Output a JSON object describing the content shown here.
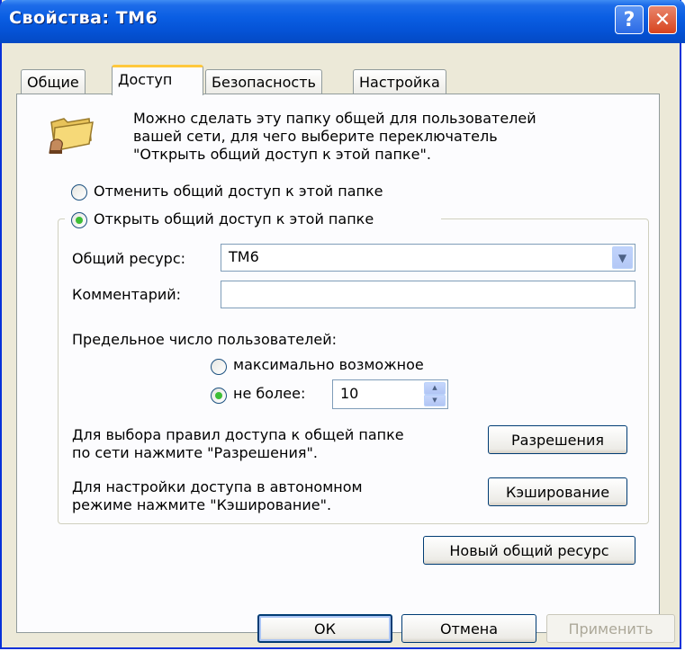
{
  "window": {
    "title": "Свойства: ТМ6"
  },
  "titlebar": {
    "help_glyph": "?",
    "close_glyph": "✕"
  },
  "tabs": [
    {
      "label": "Общие",
      "active": false
    },
    {
      "label": "Доступ",
      "active": true
    },
    {
      "label": "Безопасность",
      "active": false
    },
    {
      "label": "Настройка",
      "active": false
    }
  ],
  "intro": {
    "icon": "shared-folder-icon",
    "lines": [
      "Можно сделать эту папку общей для пользователей",
      "вашей сети, для чего выберите переключатель",
      "\"Открыть общий доступ к этой папке\"."
    ]
  },
  "sharing": {
    "option_off": "Отменить общий доступ к этой папке",
    "option_on": "Открыть общий доступ к этой папке",
    "selected": "on"
  },
  "share_name": {
    "label": "Общий ресурс:",
    "value": "ТМ6"
  },
  "comment": {
    "label": "Комментарий:",
    "value": ""
  },
  "user_limit": {
    "label": "Предельное число пользователей:",
    "option_max": "максимально возможное",
    "option_limit": "не более:",
    "selected": "limit",
    "value": "10"
  },
  "permissions": {
    "line1": "Для выбора правил доступа к общей папке",
    "line2": "по сети нажмите \"Разрешения\".",
    "button": "Разрешения"
  },
  "caching": {
    "line1": "Для настройки доступа в автономном",
    "line2": "режиме нажмите \"Кэширование\".",
    "button": "Кэширование"
  },
  "new_share_button": "Новый общий ресурс",
  "footer": {
    "ok": "ОК",
    "cancel": "Отмена",
    "apply": "Применить"
  },
  "colors": {
    "titlebar": "#0A5EE3",
    "dialog_bg": "#ECE9D8",
    "panel_bg": "#FCFCFE",
    "active_tab_accent": "#FFC83C",
    "radio_dot": "#3DBE36"
  }
}
